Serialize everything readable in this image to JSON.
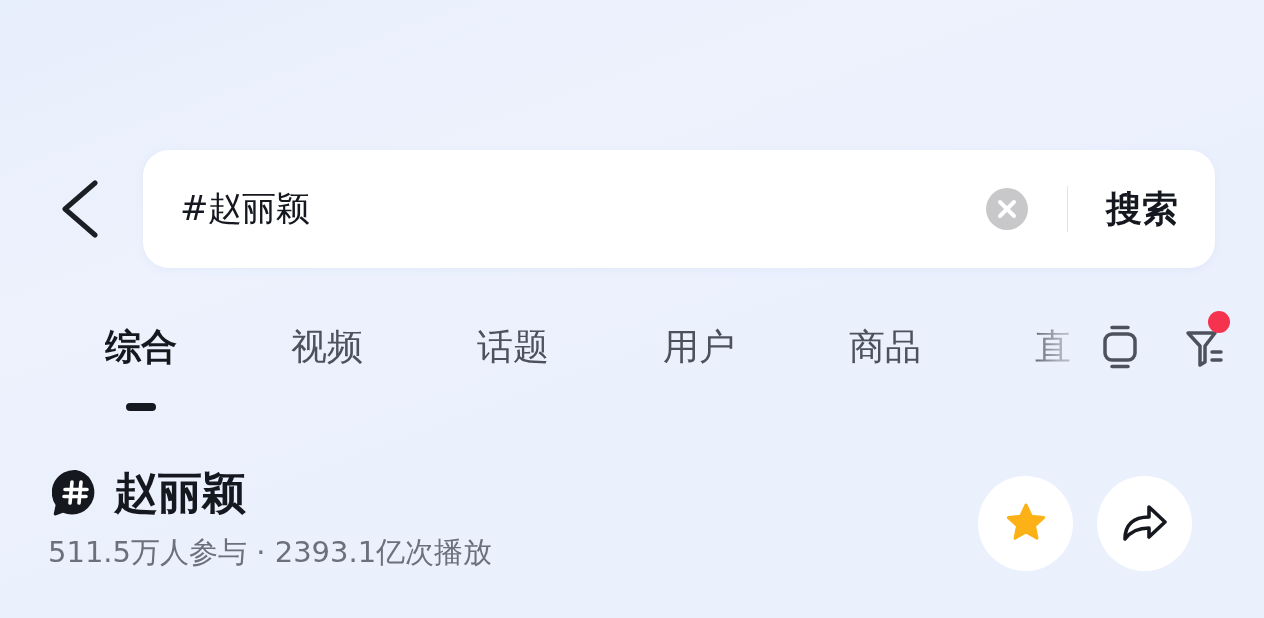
{
  "search": {
    "value": "#赵丽颖",
    "submit": "搜索"
  },
  "tabs": [
    {
      "label": "综合",
      "selected": true
    },
    {
      "label": "视频",
      "selected": false
    },
    {
      "label": "话题",
      "selected": false
    },
    {
      "label": "用户",
      "selected": false
    },
    {
      "label": "商品",
      "selected": false
    },
    {
      "label": "直",
      "selected": false
    }
  ],
  "filter": {
    "notification_dot": true
  },
  "topic": {
    "title": "赵丽颖",
    "stats": "511.5万人参与 · 2393.1亿次播放"
  }
}
